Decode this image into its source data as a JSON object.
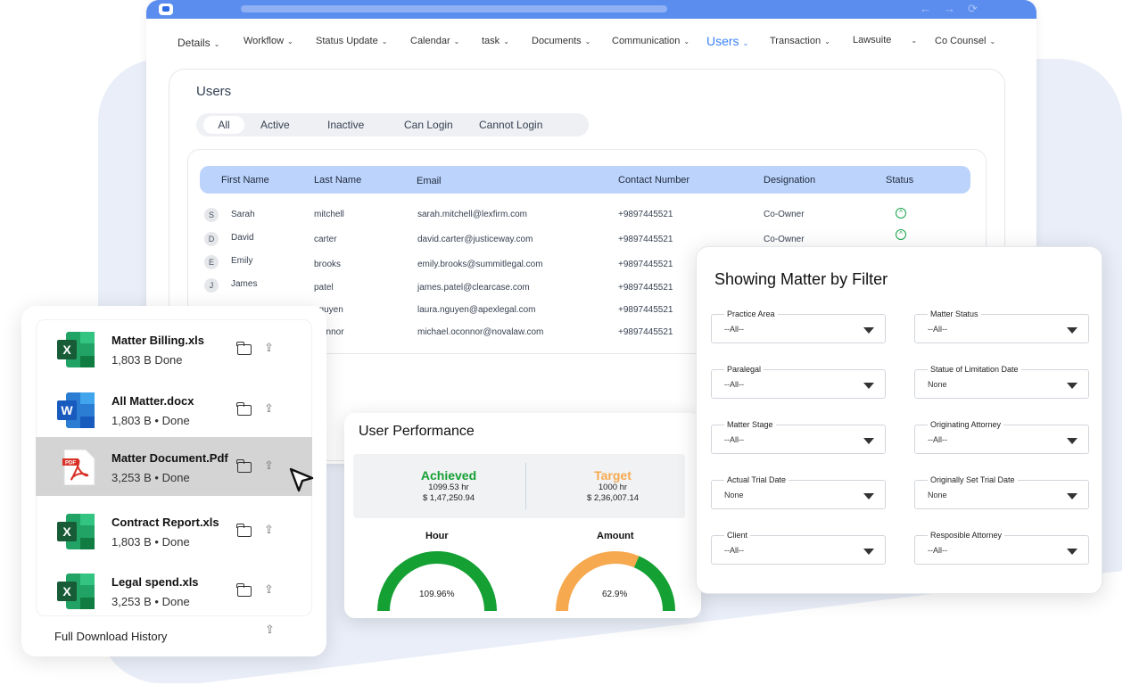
{
  "nav": [
    "Details",
    "Workflow",
    "Status Update",
    "Calendar",
    "task",
    "Documents",
    "Communication",
    "Users",
    "Transaction",
    "Lawsuite",
    "Co Counsel"
  ],
  "page_title": "Users",
  "tabs": [
    "All",
    "Active",
    "Inactive",
    "Can Login",
    "Cannot Login"
  ],
  "table": {
    "headers": [
      "First Name",
      "Last Name",
      "Email",
      "Contact Number",
      "Designation",
      "Status"
    ],
    "rows": [
      {
        "initial": "S",
        "first": "Sarah",
        "last": "mitchell",
        "email": "sarah.mitchell@lexfirm.com",
        "phone": "+9897445521",
        "designation": "Co-Owner"
      },
      {
        "initial": "D",
        "first": "David",
        "last": "carter",
        "email": "david.carter@justiceway.com",
        "phone": "+9897445521",
        "designation": "Co-Owner"
      },
      {
        "initial": "E",
        "first": "Emily",
        "last": "brooks",
        "email": "emily.brooks@summitlegal.com",
        "phone": "+9897445521",
        "designation": ""
      },
      {
        "initial": "J",
        "first": "James",
        "last": "patel",
        "email": "james.patel@clearcase.com",
        "phone": "+9897445521",
        "designation": ""
      },
      {
        "initial": "",
        "first": "",
        "last": "nguyen",
        "email": "laura.nguyen@apexlegal.com",
        "phone": "+9897445521",
        "designation": ""
      },
      {
        "initial": "",
        "first": "",
        "last": "connor",
        "email": "michael.oconnor@novalaw.com",
        "phone": "+9897445521",
        "designation": ""
      }
    ]
  },
  "downloads": {
    "files": [
      {
        "name": "Matter Billing.xls",
        "meta": "1,803 B   Done",
        "type": "xls"
      },
      {
        "name": "All Matter.docx",
        "meta": "1,803 B • Done",
        "type": "doc"
      },
      {
        "name": "Matter Document.Pdf",
        "meta": "3,253 B • Done",
        "type": "pdf"
      },
      {
        "name": "Contract Report.xls",
        "meta": "1,803 B • Done",
        "type": "xls"
      },
      {
        "name": "Legal spend.xls",
        "meta": "3,253 B • Done",
        "type": "xls"
      }
    ],
    "history_label": "Full Download History"
  },
  "performance": {
    "title": "User Performance",
    "achieved": {
      "label": "Achieved",
      "hours": "1099.53 hr",
      "amount": "$ 1,47,250.94",
      "color": "#15a034"
    },
    "target": {
      "label": "Target",
      "hours": "1000 hr",
      "amount": "$ 2,36,007.14",
      "color": "#f6a94e"
    },
    "gauges": [
      {
        "label": "Hour",
        "value": "109.96%",
        "fraction": 1.0
      },
      {
        "label": "Amount",
        "value": "62.9%",
        "fraction": 0.629
      }
    ]
  },
  "filter": {
    "title": "Showing Matter by Filter",
    "fields": [
      {
        "label": "Practice Area",
        "value": "--All--"
      },
      {
        "label": "Matter Status",
        "value": "--All--"
      },
      {
        "label": "Paralegal",
        "value": "--All--"
      },
      {
        "label": "Statue of Limitation Date",
        "value": "None"
      },
      {
        "label": "Matter Stage",
        "value": "--All--"
      },
      {
        "label": "Originating Attorney",
        "value": "--All--"
      },
      {
        "label": "Actual Trial Date",
        "value": "None"
      },
      {
        "label": "Originally Set Trial Date",
        "value": "None"
      },
      {
        "label": "Client",
        "value": "--All--"
      },
      {
        "label": "Resposible Attorney",
        "value": "--All--"
      }
    ]
  },
  "colors": {
    "accent": "#3b82f6",
    "header_bg": "#bcd3fb",
    "green": "#15a034",
    "orange": "#f6a94e"
  }
}
